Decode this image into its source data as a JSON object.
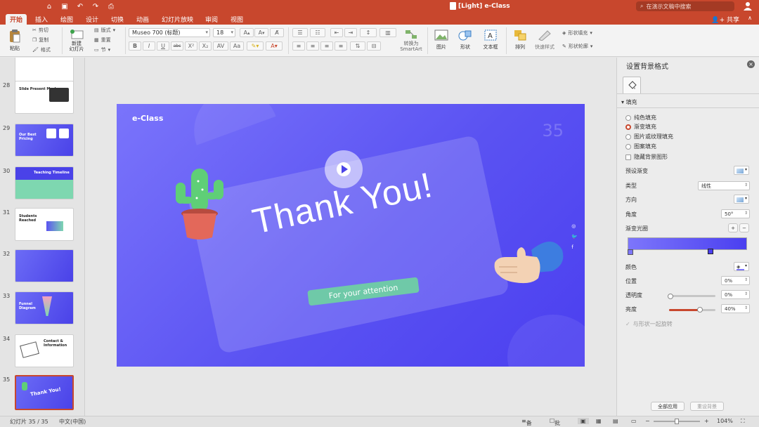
{
  "window": {
    "title": "[Light] e-Class",
    "search_placeholder": "在演示文稿中搜索"
  },
  "tabs": [
    "开始",
    "插入",
    "绘图",
    "设计",
    "切换",
    "动画",
    "幻灯片放映",
    "审阅",
    "视图"
  ],
  "share_label": "共享",
  "ribbon": {
    "paste": "粘贴",
    "cut": "剪切",
    "copy": "复制",
    "format": "格式",
    "new_slide": "新建\n幻灯片",
    "layout": "版式",
    "reset": "重置",
    "section": "节",
    "font_name": "Museo 700 (标题)",
    "font_size": "18",
    "convert_smartart": "转换为\nSmartArt",
    "picture": "图片",
    "shape": "形状",
    "textbox": "文本框",
    "arrange": "排列",
    "quick_styles": "快速样式",
    "shape_fill": "形状填充",
    "shape_outline": "形状轮廓"
  },
  "slides": [
    {
      "num": "28",
      "title": "Slide Present Mockup"
    },
    {
      "num": "29",
      "title": "Our Best Pricing"
    },
    {
      "num": "30",
      "title": "Teaching Timeline"
    },
    {
      "num": "31",
      "title": "Students Reached"
    },
    {
      "num": "32",
      "title": ""
    },
    {
      "num": "33",
      "title": "Funnel Diagram"
    },
    {
      "num": "34",
      "title": "Contact & Information"
    },
    {
      "num": "35",
      "title": "Thank You!"
    }
  ],
  "slide": {
    "brand": "e-Class",
    "page_number": "35",
    "headline": "Thank You!",
    "subtitle": "For your attention",
    "social": [
      "◎",
      "🐦",
      "f"
    ]
  },
  "pane": {
    "title": "设置背景格式",
    "section_fill": "填充",
    "options": [
      "纯色填充",
      "渐变填充",
      "图片或纹理填充",
      "图案填充"
    ],
    "selected_option": "渐变填充",
    "hide_bg": "隐藏背景图形",
    "preset_gradient": "预设渐变",
    "type_label": "类型",
    "type_value": "线性",
    "direction_label": "方向",
    "angle_label": "角度",
    "angle_value": "50°",
    "gradient_stops_label": "渐变光圈",
    "color_label": "颜色",
    "position_label": "位置",
    "position_value": "0%",
    "transparency_label": "透明度",
    "transparency_value": "0%",
    "brightness_label": "亮度",
    "brightness_value": "40%",
    "rotate_with_shape": "与形状一起旋转",
    "apply_all": "全部应用",
    "reset_bg": "重设背景"
  },
  "status": {
    "slide_counter": "幻灯片 35 / 35",
    "language": "中文(中国)",
    "notes": "备注",
    "comments": "批注",
    "zoom": "104%"
  },
  "colors": {
    "accent": "#c8472d",
    "slide_bg_start": "#7a74fb",
    "slide_bg_end": "#4b3ff0",
    "pill": "#6fc9a8"
  }
}
